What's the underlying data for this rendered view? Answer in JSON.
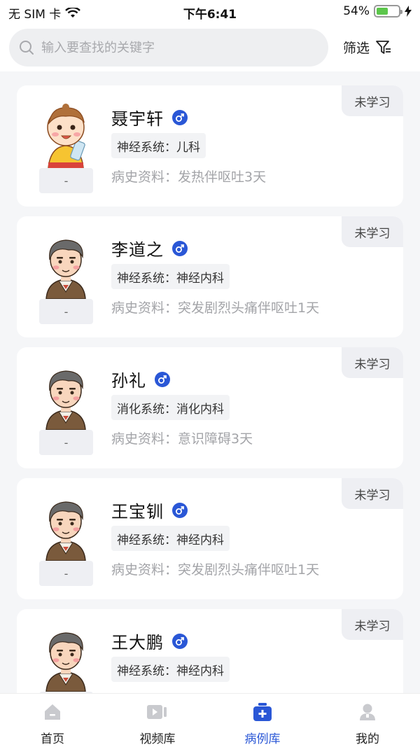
{
  "status_bar": {
    "carrier": "无 SIM 卡",
    "time": "下午6:41",
    "battery_text": "54%",
    "battery_level": 0.54
  },
  "search": {
    "placeholder": "输入要查找的关键字"
  },
  "filter_label": "筛选",
  "colors": {
    "accent": "#2a57d6",
    "gender_badge": "#2a57d6",
    "battery": "#5cc64b"
  },
  "cases": [
    {
      "status": "未学习",
      "avatar": "baby-avatar",
      "avatar_tag": "-",
      "name": "聂宇轩",
      "gender": "male",
      "system": "神经系统：儿科",
      "history": "病史资料：发热伴呕吐3天"
    },
    {
      "status": "未学习",
      "avatar": "old-man-avatar",
      "avatar_tag": "-",
      "name": "李道之",
      "gender": "male",
      "system": "神经系统：神经内科",
      "history": "病史资料：突发剧烈头痛伴呕吐1天"
    },
    {
      "status": "未学习",
      "avatar": "old-man-avatar",
      "avatar_tag": "-",
      "name": "孙礼",
      "gender": "male",
      "system": "消化系统：消化内科",
      "history": "病史资料：意识障碍3天"
    },
    {
      "status": "未学习",
      "avatar": "old-man-avatar",
      "avatar_tag": "-",
      "name": "王宝钏",
      "gender": "male",
      "system": "神经系统：神经内科",
      "history": "病史资料：突发剧烈头痛伴呕吐1天"
    },
    {
      "status": "未学习",
      "avatar": "old-man-avatar",
      "avatar_tag": "-",
      "name": "王大鹏",
      "gender": "male",
      "system": "神经系统：神经内科",
      "history": ""
    }
  ],
  "tabs": [
    {
      "label": "首页",
      "icon": "home-icon",
      "active": false
    },
    {
      "label": "视频库",
      "icon": "video-icon",
      "active": false
    },
    {
      "label": "病例库",
      "icon": "medical-kit-icon",
      "active": true
    },
    {
      "label": "我的",
      "icon": "user-icon",
      "active": false
    }
  ]
}
